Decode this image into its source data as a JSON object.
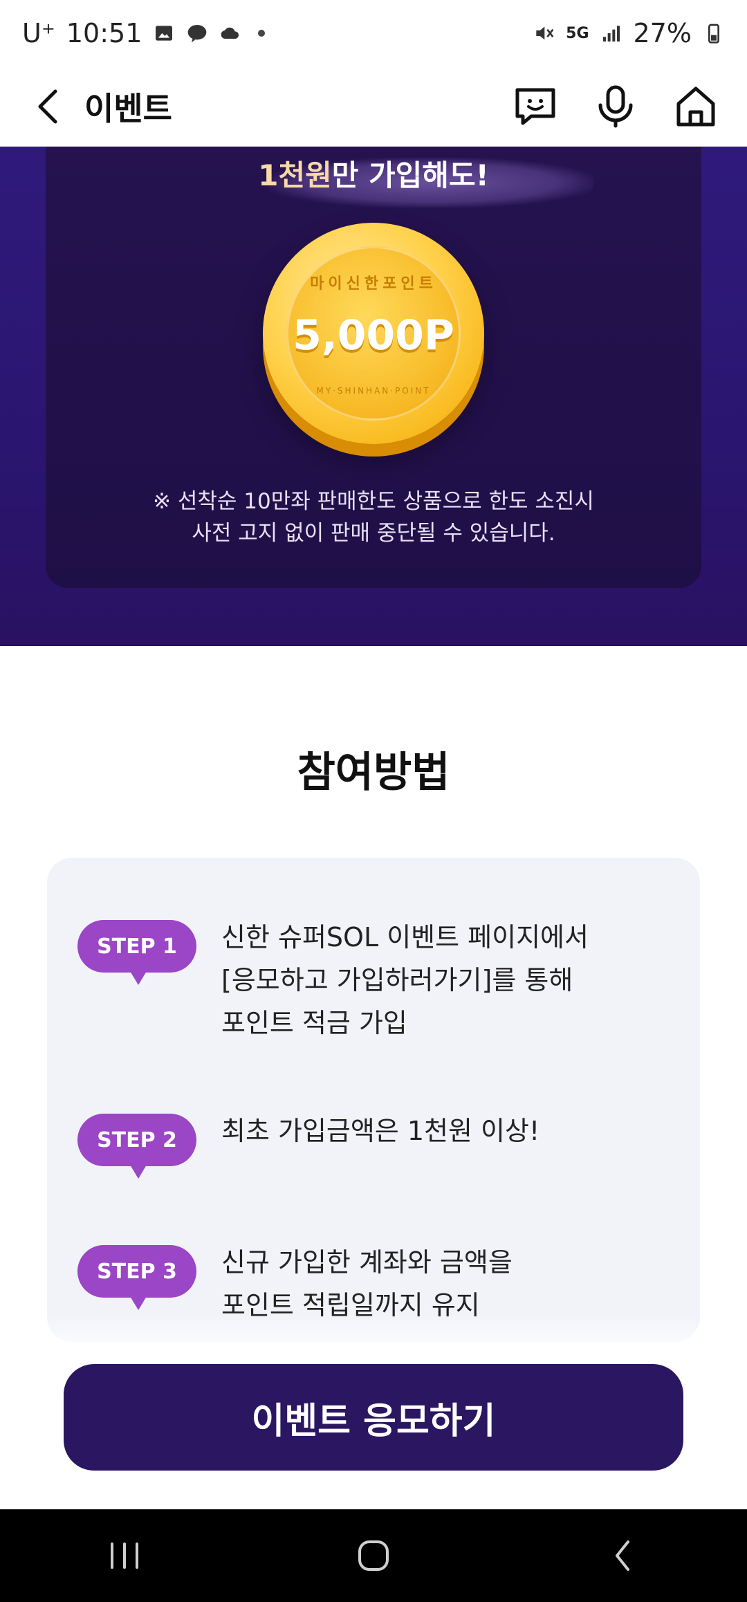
{
  "status_bar": {
    "carrier": "U⁺",
    "time": "10:51",
    "network": "5G",
    "battery": "27%"
  },
  "app_bar": {
    "title": "이벤트"
  },
  "promo": {
    "heading_accent": "1천원",
    "heading_rest": "만 가입해도!",
    "coin_top": "마이신한포인트",
    "coin_value": "5,000P",
    "coin_bottom": "MY·SHINHAN·POINT",
    "note": "※ 선착순 10만좌 판매한도 상품으로 한도 소진시\n사전 고지 없이 판매 중단될 수 있습니다."
  },
  "how": {
    "title": "참여방법",
    "steps": [
      {
        "label": "STEP 1",
        "text": "신한 슈퍼SOL 이벤트 페이지에서\n[응모하고 가입하러가기]를 통해\n포인트 적금 가입"
      },
      {
        "label": "STEP 2",
        "text": "최초 가입금액은 1천원 이상!"
      },
      {
        "label": "STEP 3",
        "text": "신규 가입한 계좌와 금액을\n포인트 적립일까지 유지"
      }
    ]
  },
  "cta": {
    "label": "이벤트 응모하기"
  },
  "colors": {
    "purple_bg": "#2a1670",
    "badge": "#9b46c6",
    "cta": "#2a1661",
    "coin": "#ffd24d"
  }
}
